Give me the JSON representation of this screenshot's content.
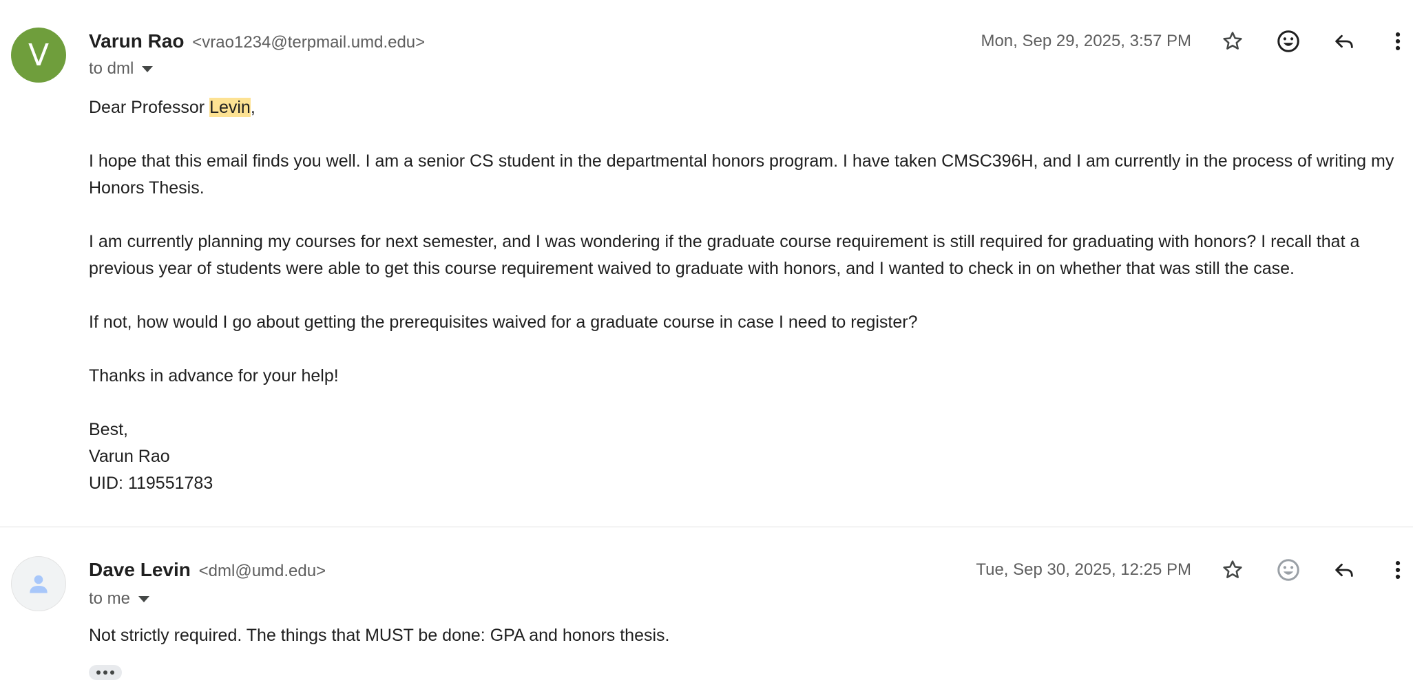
{
  "colors": {
    "avatar_green": "#6f9e3c",
    "highlight": "#fde293",
    "secondary_text": "#5e5e5e",
    "primary_text": "#1f1f1f"
  },
  "messages": [
    {
      "avatar_letter": "V",
      "sender_name": "Varun Rao",
      "sender_email": "<vrao1234@terpmail.umd.edu>",
      "to": "to dml",
      "date": "Mon, Sep 29, 2025, 3:57 PM",
      "icons": [
        "star-icon",
        "emoji-icon",
        "reply-icon",
        "more-vert-icon"
      ],
      "body": {
        "greeting_prefix": "Dear Professor ",
        "greeting_highlight": "Levin",
        "greeting_suffix": ",",
        "p1": "I hope that this email finds you well. I am a senior CS student in the departmental honors program. I have taken CMSC396H, and I am currently in the process of writing my Honors Thesis.",
        "p2": "I am currently planning my courses for next semester, and I was wondering if the graduate course requirement is still required for graduating with honors? I recall that a previous year of students were able to get this course requirement waived to graduate with honors, and I wanted to check in on whether that was still the case.",
        "p3": "If not, how would I go about getting the prerequisites waived for a graduate course in case I need to register?",
        "p4": "Thanks in advance for your help!",
        "signoff": "Best,",
        "sig_name": "Varun Rao",
        "sig_uid": "UID: 119551783"
      }
    },
    {
      "avatar_icon": "person-icon",
      "sender_name": "Dave Levin",
      "sender_email": "<dml@umd.edu>",
      "to": "to me",
      "date": "Tue, Sep 30, 2025, 12:25 PM",
      "icons": [
        "star-icon",
        "emoji-icon",
        "reply-icon",
        "more-vert-icon"
      ],
      "body": {
        "text": "Not strictly required. The things that MUST be done: GPA and honors thesis."
      },
      "show_trimmed": "•••"
    }
  ]
}
